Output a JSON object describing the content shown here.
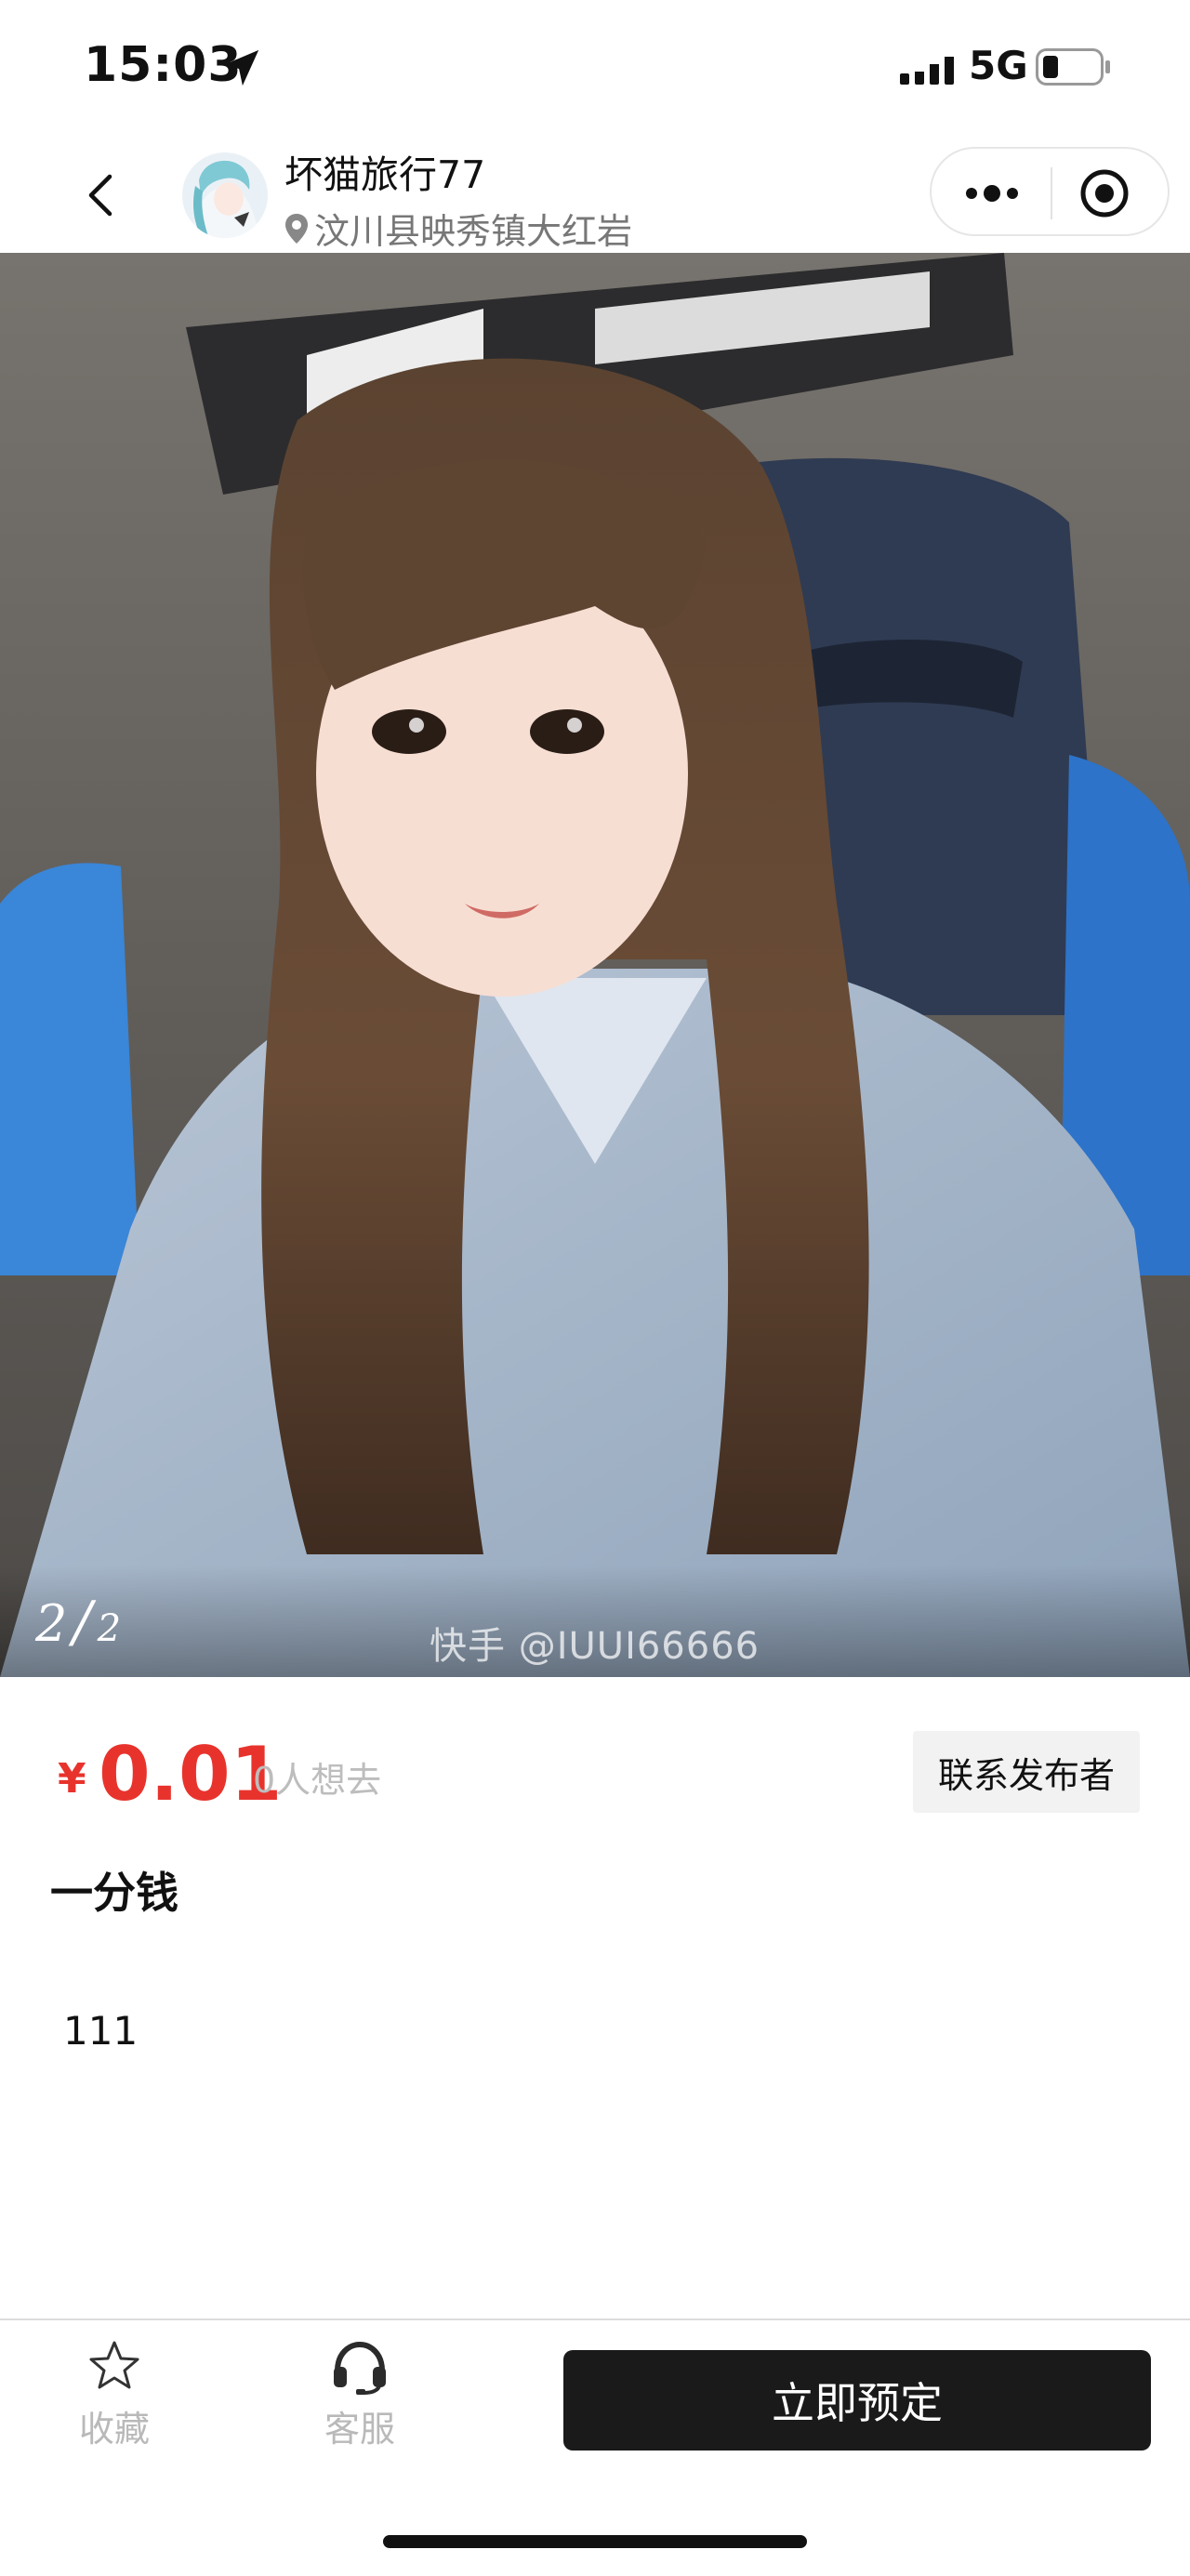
{
  "status_bar": {
    "time": "15:03",
    "network": "5G",
    "icons": [
      "location-arrow-icon",
      "signal-icon",
      "battery-icon"
    ]
  },
  "header": {
    "shop_name": "坏猫旅行77",
    "location": "汶川县映秀镇大红岩",
    "icons": [
      "back-icon",
      "avatar",
      "location-pin-icon",
      "more-icon",
      "close-circle-icon"
    ]
  },
  "gallery": {
    "current": "2",
    "separator": "/",
    "total": "2",
    "watermark": "快手 @IUUI66666"
  },
  "product": {
    "currency": "¥",
    "price": "0.01",
    "want_count": "0人想去",
    "contact_label": "联系发布者",
    "title": "一分钱",
    "description": "111"
  },
  "bottom_bar": {
    "favorite_label": "收藏",
    "service_label": "客服",
    "book_label": "立即预定",
    "icons": [
      "star-icon",
      "headset-icon"
    ]
  },
  "colors": {
    "accent": "#e8332d",
    "book_button": "#1a1a1a",
    "muted_text": "#bdbdbd"
  }
}
